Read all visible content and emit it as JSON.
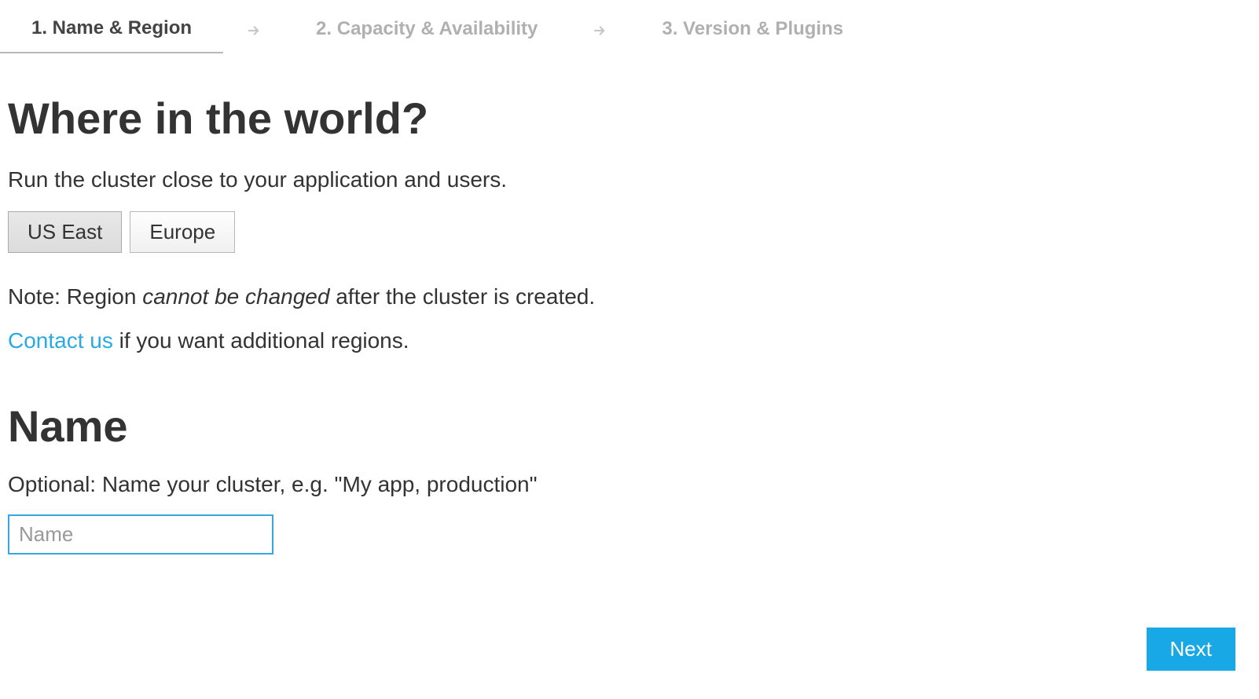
{
  "wizard": {
    "steps": [
      {
        "label": "1. Name & Region",
        "active": true
      },
      {
        "label": "2. Capacity & Availability",
        "active": false
      },
      {
        "label": "3. Version & Plugins",
        "active": false
      }
    ]
  },
  "region_section": {
    "heading": "Where in the world?",
    "subtitle": "Run the cluster close to your application and users.",
    "regions": [
      {
        "label": "US East",
        "selected": true
      },
      {
        "label": "Europe",
        "selected": false
      }
    ],
    "note_prefix": "Note: Region ",
    "note_italic": "cannot be changed",
    "note_suffix": " after the cluster is created.",
    "contact_link": "Contact us",
    "contact_suffix": " if you want additional regions."
  },
  "name_section": {
    "heading": "Name",
    "hint": "Optional: Name your cluster, e.g. \"My app, production\"",
    "placeholder": "Name",
    "value": ""
  },
  "footer": {
    "next_label": "Next"
  }
}
